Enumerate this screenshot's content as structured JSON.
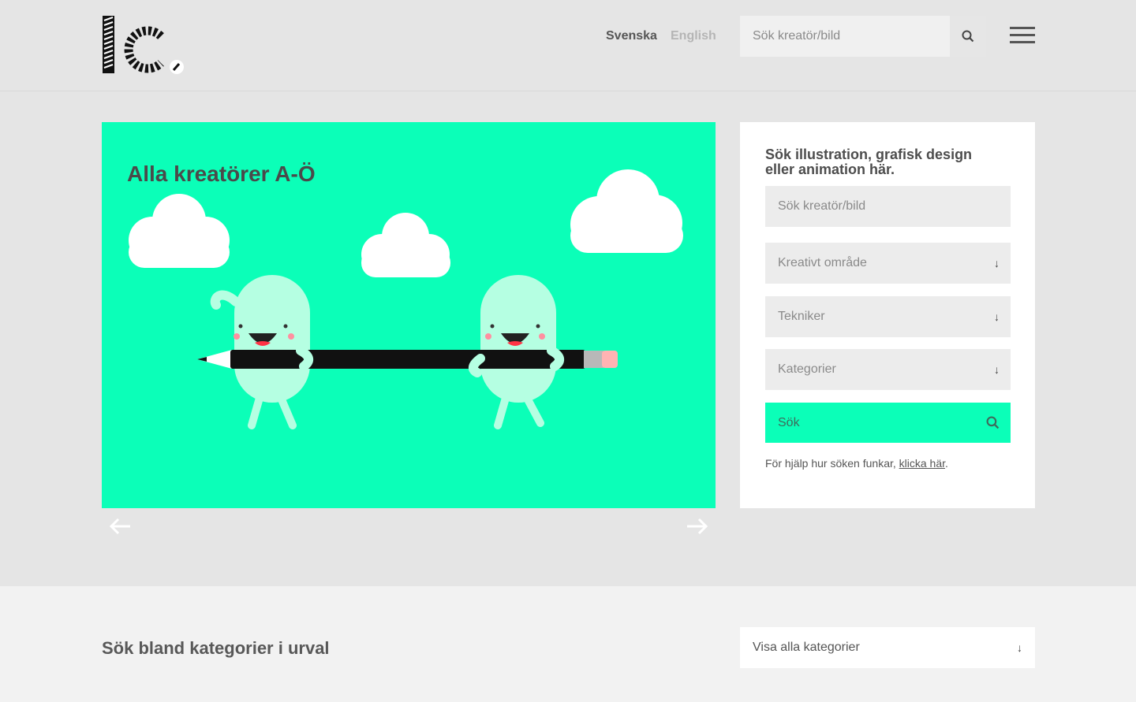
{
  "header": {
    "logo_alt": "lc.",
    "languages": [
      {
        "label": "Svenska",
        "active": true
      },
      {
        "label": "English",
        "active": false
      }
    ],
    "search_placeholder": "Sök kreatör/bild",
    "search_icon": "search-icon",
    "menu_icon": "hamburger-menu-icon"
  },
  "hero": {
    "title": "Alla kreatörer A-Ö",
    "background": "#0bffb8",
    "prev_icon": "arrow-left-icon",
    "next_icon": "arrow-right-icon"
  },
  "search_panel": {
    "heading": "Sök illustration, grafisk design eller animation här.",
    "search_placeholder": "Sök kreatör/bild",
    "selects": [
      {
        "label": "Kreativt område",
        "icon": "arrow-down-icon"
      },
      {
        "label": "Tekniker",
        "icon": "arrow-down-icon"
      },
      {
        "label": "Kategorier",
        "icon": "arrow-down-icon"
      }
    ],
    "submit_label": "Sök",
    "help_prefix": "För hjälp hur söken funkar, ",
    "help_link": "klicka här",
    "help_suffix": "."
  },
  "bottom": {
    "title": "Sök bland kategorier i urval",
    "select_label": "Visa alla kategorier"
  },
  "colors": {
    "accent": "#0bffb8",
    "page_bg": "#e5e5e5",
    "bottom_bg": "#f2f2f2"
  }
}
